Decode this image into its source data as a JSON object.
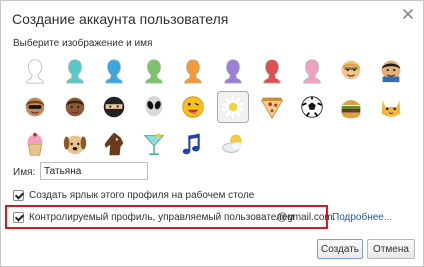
{
  "dialog": {
    "title": "Создание аккаунта пользователя",
    "subtitle": "Выберите изображение и имя"
  },
  "avatars": [
    {
      "name": "avatar-silhouette-white",
      "color": "#ffffff"
    },
    {
      "name": "avatar-silhouette-cyan",
      "color": "#58c9c8"
    },
    {
      "name": "avatar-silhouette-blue",
      "color": "#3aa7e0"
    },
    {
      "name": "avatar-silhouette-green",
      "color": "#7cc46a"
    },
    {
      "name": "avatar-silhouette-orange",
      "color": "#f19a3a"
    },
    {
      "name": "avatar-silhouette-purple",
      "color": "#9b7fd8"
    },
    {
      "name": "avatar-silhouette-red",
      "color": "#e05050"
    },
    {
      "name": "avatar-silhouette-pink",
      "color": "#f0a0c0"
    },
    {
      "name": "avatar-businessman-cartoon",
      "color": "#d9a04a"
    },
    {
      "name": "avatar-ninja-cartoon",
      "color": "#2f6fb5"
    },
    {
      "name": "avatar-woman-sunglasses",
      "color": "#6b4a2a"
    },
    {
      "name": "avatar-man-cartoon",
      "color": "#7a4a2a"
    },
    {
      "name": "avatar-ninja",
      "color": "#222222"
    },
    {
      "name": "avatar-alien",
      "color": "#cfcfcf"
    },
    {
      "name": "avatar-smiley",
      "color": "#f6c21a"
    },
    {
      "name": "avatar-flower",
      "color": "#f5d33a"
    },
    {
      "name": "avatar-pizza",
      "color": "#e8a85a"
    },
    {
      "name": "avatar-soccer-ball",
      "color": "#222222"
    },
    {
      "name": "avatar-hamburger",
      "color": "#a0632a"
    },
    {
      "name": "avatar-cat",
      "color": "#f2b73a"
    },
    {
      "name": "avatar-cupcake",
      "color": "#e07aa0"
    },
    {
      "name": "avatar-dog",
      "color": "#c9a06a"
    },
    {
      "name": "avatar-horse",
      "color": "#6a3a1a"
    },
    {
      "name": "avatar-cocktail",
      "color": "#6ad0c0"
    },
    {
      "name": "avatar-music-note",
      "color": "#2244aa"
    },
    {
      "name": "avatar-sun-cloud",
      "color": "#f5c842"
    }
  ],
  "form": {
    "name_label": "Имя:",
    "name_value": "Татьяна",
    "shortcut_label": "Создать ярлык этого профиля на рабочем столе",
    "supervised_label": "Контролируемый профиль, управляемый пользователем",
    "email": "@gmail.com.",
    "more_link": "Подробнее..."
  },
  "buttons": {
    "create": "Создать",
    "cancel": "Отмена"
  },
  "colors": {
    "highlight": "#d8191f",
    "link": "#2255cc"
  }
}
